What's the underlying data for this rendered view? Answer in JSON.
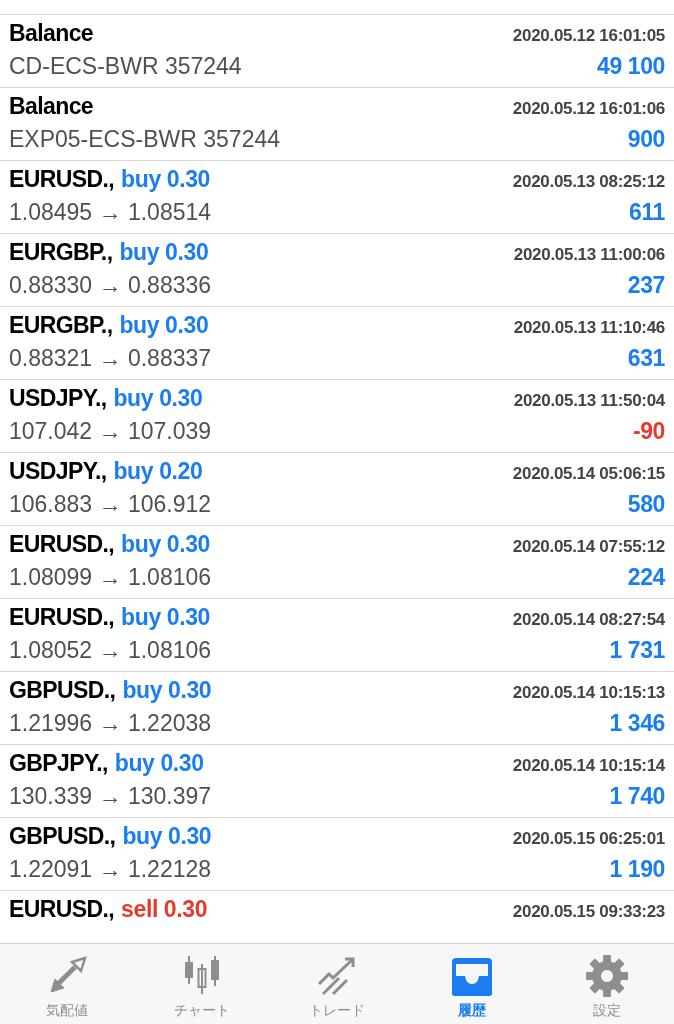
{
  "deals": [
    {
      "kind": "balance",
      "title": "Balance",
      "time": "2020.05.12 16:01:05",
      "detail": "CD-ECS-BWR 357244",
      "profit": "49 100",
      "negative": false
    },
    {
      "kind": "balance",
      "title": "Balance",
      "time": "2020.05.12 16:01:06",
      "detail": "EXP05-ECS-BWR 357244",
      "profit": "900",
      "negative": false
    },
    {
      "kind": "trade",
      "title": "EURUSD.,",
      "sell": false,
      "order": "buy 0.30",
      "time": "2020.05.13 08:25:12",
      "detail": "1.08495 → 1.08514",
      "profit": "611",
      "negative": false
    },
    {
      "kind": "trade",
      "title": "EURGBP.,",
      "sell": false,
      "order": "buy 0.30",
      "time": "2020.05.13 11:00:06",
      "detail": "0.88330 → 0.88336",
      "profit": "237",
      "negative": false
    },
    {
      "kind": "trade",
      "title": "EURGBP.,",
      "sell": false,
      "order": "buy 0.30",
      "time": "2020.05.13 11:10:46",
      "detail": "0.88321 → 0.88337",
      "profit": "631",
      "negative": false
    },
    {
      "kind": "trade",
      "title": "USDJPY.,",
      "sell": false,
      "order": "buy 0.30",
      "time": "2020.05.13 11:50:04",
      "detail": "107.042 → 107.039",
      "profit": "-90",
      "negative": true
    },
    {
      "kind": "trade",
      "title": "USDJPY.,",
      "sell": false,
      "order": "buy 0.20",
      "time": "2020.05.14 05:06:15",
      "detail": "106.883 → 106.912",
      "profit": "580",
      "negative": false
    },
    {
      "kind": "trade",
      "title": "EURUSD.,",
      "sell": false,
      "order": "buy 0.30",
      "time": "2020.05.14 07:55:12",
      "detail": "1.08099 → 1.08106",
      "profit": "224",
      "negative": false
    },
    {
      "kind": "trade",
      "title": "EURUSD.,",
      "sell": false,
      "order": "buy 0.30",
      "time": "2020.05.14 08:27:54",
      "detail": "1.08052 → 1.08106",
      "profit": "1 731",
      "negative": false
    },
    {
      "kind": "trade",
      "title": "GBPUSD.,",
      "sell": false,
      "order": "buy 0.30",
      "time": "2020.05.14 10:15:13",
      "detail": "1.21996 → 1.22038",
      "profit": "1 346",
      "negative": false
    },
    {
      "kind": "trade",
      "title": "GBPJPY.,",
      "sell": false,
      "order": "buy 0.30",
      "time": "2020.05.14 10:15:14",
      "detail": "130.339 → 130.397",
      "profit": "1 740",
      "negative": false
    },
    {
      "kind": "trade",
      "title": "GBPUSD.,",
      "sell": false,
      "order": "buy 0.30",
      "time": "2020.05.15 06:25:01",
      "detail": "1.22091 → 1.22128",
      "profit": "1 190",
      "negative": false
    },
    {
      "kind": "trade",
      "title": "EURUSD.,",
      "sell": true,
      "order": "sell 0.30",
      "time": "2020.05.15 09:33:23"
    }
  ],
  "tabs": [
    {
      "kind": "quotes",
      "label": "気配値",
      "selected": false
    },
    {
      "kind": "chart",
      "label": "チャート",
      "selected": false
    },
    {
      "kind": "trade",
      "label": "トレード",
      "selected": false
    },
    {
      "kind": "history",
      "label": "履歴",
      "selected": true
    },
    {
      "kind": "settings",
      "label": "設定",
      "selected": false
    }
  ]
}
